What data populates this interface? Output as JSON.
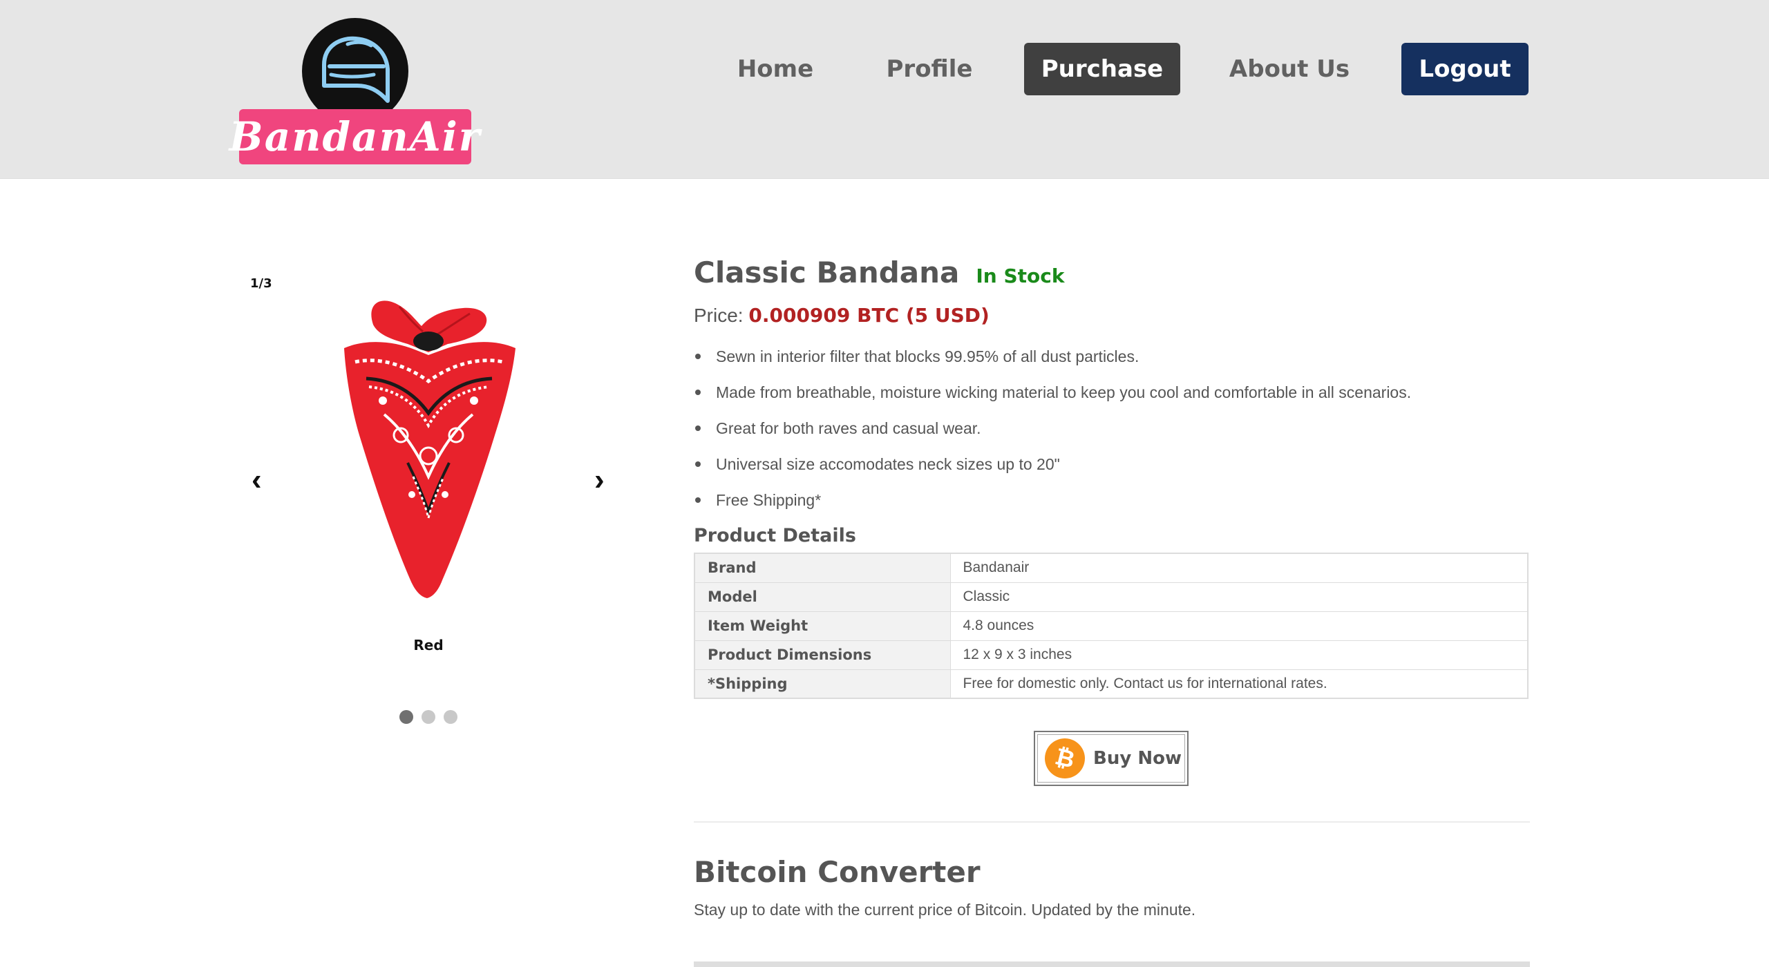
{
  "header": {
    "logo_text": "BandanAir",
    "nav": [
      {
        "label": "Home",
        "active": false
      },
      {
        "label": "Profile",
        "active": false
      },
      {
        "label": "Purchase",
        "active": true
      },
      {
        "label": "About Us",
        "active": false
      },
      {
        "label": "Logout",
        "active": false
      }
    ],
    "colors": {
      "header_bg": "#e6e6e6",
      "logo_pink": "#f0457e",
      "active_tab": "#404040",
      "logout_bg": "#15305f"
    }
  },
  "carousel": {
    "counter": "1/3",
    "prev_icon": "chevron-left-icon",
    "next_icon": "chevron-right-icon",
    "caption": "Red",
    "slides_total": 3,
    "active_index": 0
  },
  "product": {
    "title": "Classic Bandana",
    "stock": "In Stock",
    "price_label": "Price:",
    "price_value": "0.000909 BTC (5 USD)",
    "features": [
      "Sewn in interior filter that blocks 99.95% of all dust particles.",
      "Made from breathable, moisture wicking material to keep you cool and comfortable in all scenarios.",
      "Great for both raves and casual wear.",
      "Universal size accomodates neck sizes up to 20\"",
      "Free Shipping*"
    ],
    "details_title": "Product Details",
    "details": [
      {
        "key": "Brand",
        "value": "Bandanair"
      },
      {
        "key": "Model",
        "value": "Classic"
      },
      {
        "key": "Item Weight",
        "value": "4.8 ounces"
      },
      {
        "key": "Product Dimensions",
        "value": "12 x 9 x 3 inches"
      },
      {
        "key": "*Shipping",
        "value": "Free for domestic only. Contact us for international rates."
      }
    ],
    "buy_button": {
      "icon": "bitcoin-icon",
      "label": "Buy Now"
    },
    "colors": {
      "price": "#b22222",
      "stock": "#1a8a1a",
      "bitcoin": "#f7931a"
    }
  },
  "converter": {
    "title": "Bitcoin Converter",
    "subtitle": "Stay up to date with the current price of Bitcoin. Updated by the minute."
  }
}
